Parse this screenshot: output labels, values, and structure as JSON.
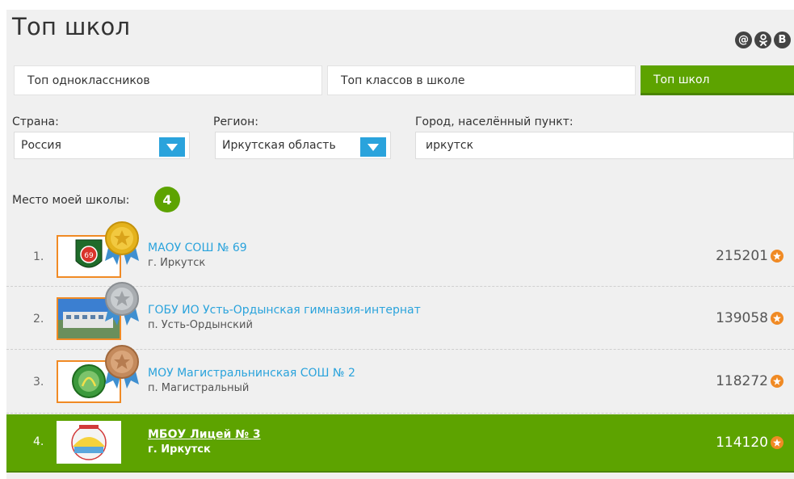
{
  "header": {
    "title": "Топ школ",
    "socials": [
      {
        "name": "mail",
        "glyph": "@"
      },
      {
        "name": "odnoklassniki",
        "glyph": "ок"
      },
      {
        "name": "vkontakte",
        "glyph": "B"
      }
    ]
  },
  "tabs": [
    {
      "label": "Топ одноклассников",
      "active": false
    },
    {
      "label": "Топ классов в школе",
      "active": false
    },
    {
      "label": "Топ школ",
      "active": true
    }
  ],
  "filters": {
    "country": {
      "label": "Страна:",
      "value": "Россия"
    },
    "region": {
      "label": "Регион:",
      "value": "Иркутская область"
    },
    "city": {
      "label": "Город, населённый пункт:",
      "value": "иркутск"
    }
  },
  "my_place": {
    "label": "Место моей школы:",
    "value": "4"
  },
  "schools": [
    {
      "rank": "1.",
      "name": "МАОУ СОШ № 69",
      "city": "г. Иркутск",
      "score": "215201",
      "medal": "gold",
      "highlight": false
    },
    {
      "rank": "2.",
      "name": "ГОБУ ИО Усть-Ордынская гимназия-интернат",
      "city": "п. Усть-Ордынский",
      "score": "139058",
      "medal": "silver",
      "highlight": false
    },
    {
      "rank": "3.",
      "name": "МОУ Магистральнинская СОШ № 2",
      "city": "п. Магистральный",
      "score": "118272",
      "medal": "bronze",
      "highlight": false
    },
    {
      "rank": "4.",
      "name": "МБОУ Лицей № 3",
      "city": "г. Иркутск",
      "score": "114120",
      "medal": "none",
      "highlight": true
    }
  ],
  "colors": {
    "accent": "#5da300",
    "link": "#2aa3dc",
    "star": "#f08a24",
    "panel": "#f0f0f0"
  }
}
